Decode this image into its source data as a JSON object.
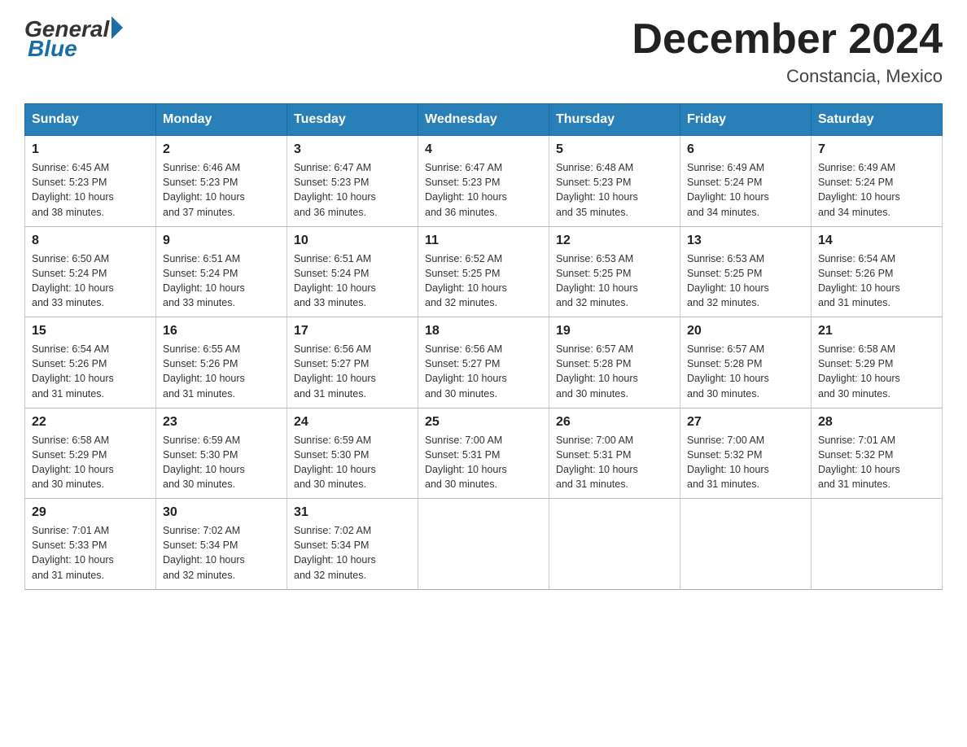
{
  "header": {
    "logo_general": "General",
    "logo_blue": "Blue",
    "title": "December 2024",
    "location": "Constancia, Mexico"
  },
  "days_of_week": [
    "Sunday",
    "Monday",
    "Tuesday",
    "Wednesday",
    "Thursday",
    "Friday",
    "Saturday"
  ],
  "weeks": [
    [
      {
        "day": "1",
        "sunrise": "6:45 AM",
        "sunset": "5:23 PM",
        "daylight": "10 hours and 38 minutes."
      },
      {
        "day": "2",
        "sunrise": "6:46 AM",
        "sunset": "5:23 PM",
        "daylight": "10 hours and 37 minutes."
      },
      {
        "day": "3",
        "sunrise": "6:47 AM",
        "sunset": "5:23 PM",
        "daylight": "10 hours and 36 minutes."
      },
      {
        "day": "4",
        "sunrise": "6:47 AM",
        "sunset": "5:23 PM",
        "daylight": "10 hours and 36 minutes."
      },
      {
        "day": "5",
        "sunrise": "6:48 AM",
        "sunset": "5:23 PM",
        "daylight": "10 hours and 35 minutes."
      },
      {
        "day": "6",
        "sunrise": "6:49 AM",
        "sunset": "5:24 PM",
        "daylight": "10 hours and 34 minutes."
      },
      {
        "day": "7",
        "sunrise": "6:49 AM",
        "sunset": "5:24 PM",
        "daylight": "10 hours and 34 minutes."
      }
    ],
    [
      {
        "day": "8",
        "sunrise": "6:50 AM",
        "sunset": "5:24 PM",
        "daylight": "10 hours and 33 minutes."
      },
      {
        "day": "9",
        "sunrise": "6:51 AM",
        "sunset": "5:24 PM",
        "daylight": "10 hours and 33 minutes."
      },
      {
        "day": "10",
        "sunrise": "6:51 AM",
        "sunset": "5:24 PM",
        "daylight": "10 hours and 33 minutes."
      },
      {
        "day": "11",
        "sunrise": "6:52 AM",
        "sunset": "5:25 PM",
        "daylight": "10 hours and 32 minutes."
      },
      {
        "day": "12",
        "sunrise": "6:53 AM",
        "sunset": "5:25 PM",
        "daylight": "10 hours and 32 minutes."
      },
      {
        "day": "13",
        "sunrise": "6:53 AM",
        "sunset": "5:25 PM",
        "daylight": "10 hours and 32 minutes."
      },
      {
        "day": "14",
        "sunrise": "6:54 AM",
        "sunset": "5:26 PM",
        "daylight": "10 hours and 31 minutes."
      }
    ],
    [
      {
        "day": "15",
        "sunrise": "6:54 AM",
        "sunset": "5:26 PM",
        "daylight": "10 hours and 31 minutes."
      },
      {
        "day": "16",
        "sunrise": "6:55 AM",
        "sunset": "5:26 PM",
        "daylight": "10 hours and 31 minutes."
      },
      {
        "day": "17",
        "sunrise": "6:56 AM",
        "sunset": "5:27 PM",
        "daylight": "10 hours and 31 minutes."
      },
      {
        "day": "18",
        "sunrise": "6:56 AM",
        "sunset": "5:27 PM",
        "daylight": "10 hours and 30 minutes."
      },
      {
        "day": "19",
        "sunrise": "6:57 AM",
        "sunset": "5:28 PM",
        "daylight": "10 hours and 30 minutes."
      },
      {
        "day": "20",
        "sunrise": "6:57 AM",
        "sunset": "5:28 PM",
        "daylight": "10 hours and 30 minutes."
      },
      {
        "day": "21",
        "sunrise": "6:58 AM",
        "sunset": "5:29 PM",
        "daylight": "10 hours and 30 minutes."
      }
    ],
    [
      {
        "day": "22",
        "sunrise": "6:58 AM",
        "sunset": "5:29 PM",
        "daylight": "10 hours and 30 minutes."
      },
      {
        "day": "23",
        "sunrise": "6:59 AM",
        "sunset": "5:30 PM",
        "daylight": "10 hours and 30 minutes."
      },
      {
        "day": "24",
        "sunrise": "6:59 AM",
        "sunset": "5:30 PM",
        "daylight": "10 hours and 30 minutes."
      },
      {
        "day": "25",
        "sunrise": "7:00 AM",
        "sunset": "5:31 PM",
        "daylight": "10 hours and 30 minutes."
      },
      {
        "day": "26",
        "sunrise": "7:00 AM",
        "sunset": "5:31 PM",
        "daylight": "10 hours and 31 minutes."
      },
      {
        "day": "27",
        "sunrise": "7:00 AM",
        "sunset": "5:32 PM",
        "daylight": "10 hours and 31 minutes."
      },
      {
        "day": "28",
        "sunrise": "7:01 AM",
        "sunset": "5:32 PM",
        "daylight": "10 hours and 31 minutes."
      }
    ],
    [
      {
        "day": "29",
        "sunrise": "7:01 AM",
        "sunset": "5:33 PM",
        "daylight": "10 hours and 31 minutes."
      },
      {
        "day": "30",
        "sunrise": "7:02 AM",
        "sunset": "5:34 PM",
        "daylight": "10 hours and 32 minutes."
      },
      {
        "day": "31",
        "sunrise": "7:02 AM",
        "sunset": "5:34 PM",
        "daylight": "10 hours and 32 minutes."
      },
      null,
      null,
      null,
      null
    ]
  ],
  "labels": {
    "sunrise": "Sunrise:",
    "sunset": "Sunset:",
    "daylight": "Daylight:"
  }
}
